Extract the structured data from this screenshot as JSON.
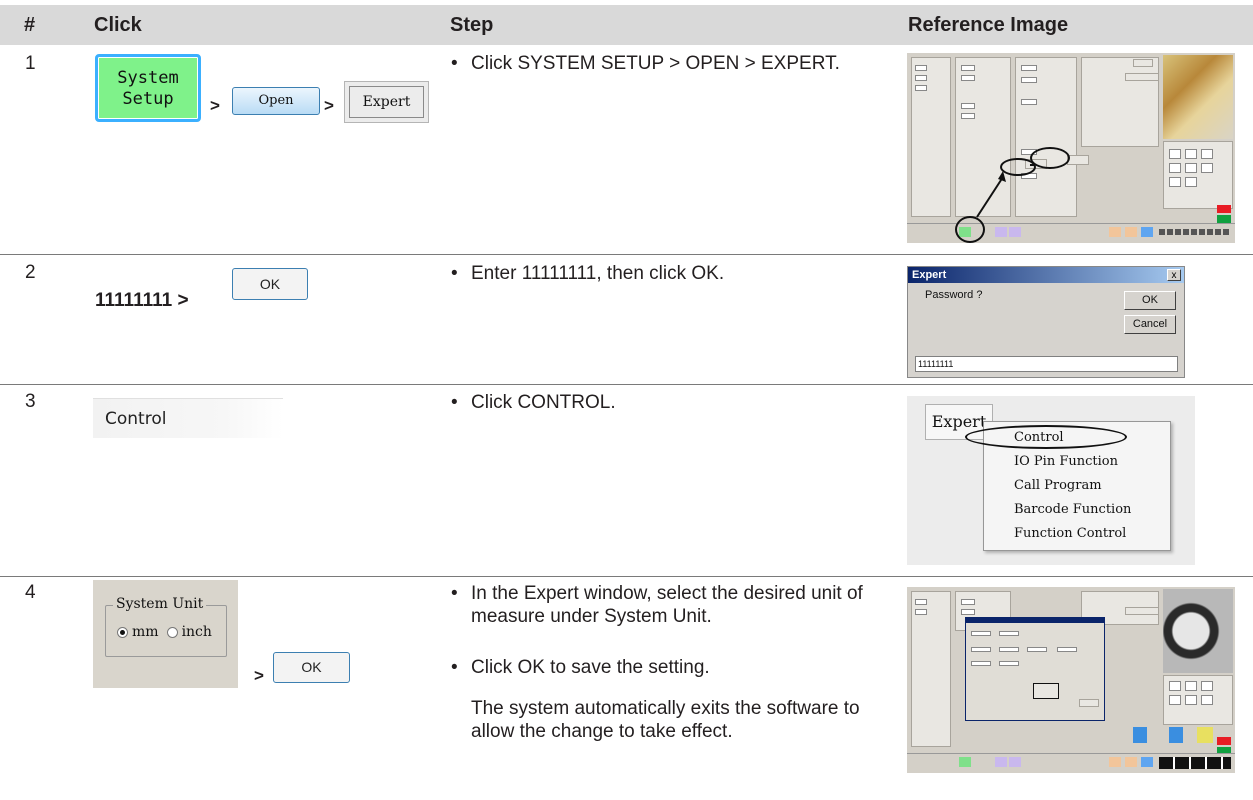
{
  "table": {
    "headers": {
      "num": "#",
      "click": "Click",
      "step": "Step",
      "reference": "Reference Image"
    },
    "separator": ">",
    "bullet": "•",
    "rows": [
      {
        "num": "1",
        "click": {
          "system_setup_line1": "System",
          "system_setup_line2": "Setup",
          "open": "Open",
          "expert": "Expert"
        },
        "steps": [
          "Click SYSTEM SETUP > OPEN > EXPERT."
        ]
      },
      {
        "num": "2",
        "click": {
          "password": "11111111 >",
          "ok": "OK"
        },
        "steps": [
          "Enter 11111111, then click OK."
        ],
        "reference": {
          "title": "Expert",
          "close": "x",
          "prompt": "Password ?",
          "ok": "OK",
          "cancel": "Cancel",
          "value": "11111111"
        }
      },
      {
        "num": "3",
        "click": {
          "control": "Control"
        },
        "steps": [
          "Click CONTROL."
        ],
        "reference": {
          "menu_title": "Expert",
          "items": [
            "Control",
            "IO Pin Function",
            "Call Program",
            "Barcode Function",
            "Function Control"
          ]
        }
      },
      {
        "num": "4",
        "click": {
          "group": "System Unit",
          "mm": "mm",
          "inch": "inch",
          "selected": "mm",
          "ok": "OK"
        },
        "steps": [
          "In the Expert window, select the desired unit of measure under System Unit.",
          "Click OK to save the setting."
        ],
        "note": "The system automatically exits the software to allow the change to take effect."
      }
    ]
  }
}
